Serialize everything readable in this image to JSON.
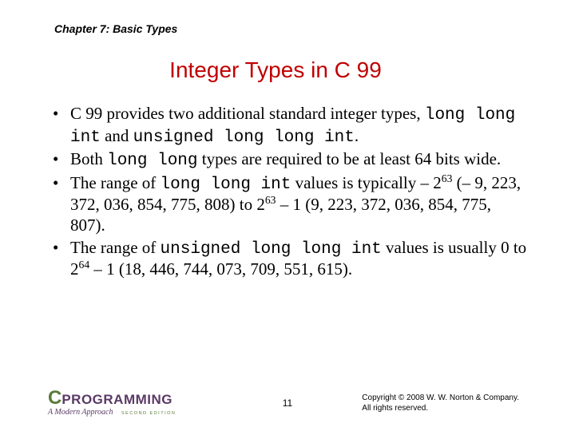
{
  "chapter": "Chapter 7: Basic Types",
  "title": "Integer Types in C 99",
  "bullets": [
    {
      "parts": [
        {
          "t": "C 99 provides two additional standard integer types, "
        },
        {
          "t": "long long int",
          "code": true
        },
        {
          "t": " and "
        },
        {
          "t": "unsigned long long int",
          "code": true
        },
        {
          "t": "."
        }
      ]
    },
    {
      "parts": [
        {
          "t": "Both "
        },
        {
          "t": "long long",
          "code": true
        },
        {
          "t": " types are required to be at least 64 bits wide."
        }
      ]
    },
    {
      "parts": [
        {
          "t": "The range of "
        },
        {
          "t": "long long int",
          "code": true
        },
        {
          "t": " values is typically – 2"
        },
        {
          "t": "63",
          "sup": true
        },
        {
          "t": " (– 9, 223, 372, 036, 854, 775, 808) to 2"
        },
        {
          "t": "63",
          "sup": true
        },
        {
          "t": " – 1 (9, 223, 372, 036, 854, 775, 807)."
        }
      ]
    },
    {
      "parts": [
        {
          "t": "The range of "
        },
        {
          "t": "unsigned long long int",
          "code": true
        },
        {
          "t": " values is usually 0 to 2"
        },
        {
          "t": "64",
          "sup": true
        },
        {
          "t": " – 1 (18, 446, 744, 073, 709, 551, 615)."
        }
      ]
    }
  ],
  "footer": {
    "logo_c": "C",
    "logo_prog": "PROGRAMMING",
    "logo_sub": "A Modern Approach",
    "logo_ed": "SECOND EDITION",
    "page": "11",
    "copyright_l1": "Copyright © 2008 W. W. Norton & Company.",
    "copyright_l2": "All rights reserved."
  }
}
